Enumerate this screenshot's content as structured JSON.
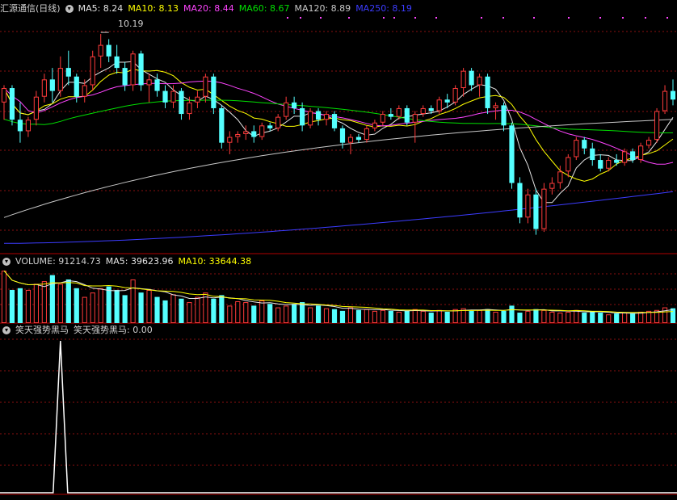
{
  "colors": {
    "up": "#ff3b3b",
    "down": "#55ffff",
    "frame": "#b00000",
    "grid": "#8a1010",
    "ma5": "#e6e6e6",
    "ma10": "#ffff00",
    "ma20": "#ff44ff",
    "ma60": "#00e000",
    "ma120": "#c8c8c8",
    "ma250": "#3c3cff",
    "label": "#d0d0d0"
  },
  "header": {
    "title": "汇源通信(日线)",
    "ma5": "MA5: 8.24",
    "ma10": "MA10: 8.13",
    "ma20": "MA20: 8.44",
    "ma60": "MA60: 8.67",
    "ma120": "MA120: 8.89",
    "ma250": "MA250: 8.19"
  },
  "volume_header": {
    "vol": "VOLUME: 91214.73",
    "ma5": "MA5: 39623.96",
    "ma10": "MA10: 33644.38"
  },
  "indicator_header": {
    "name": "笑天强势黑马",
    "value": "笑天强势黑马: 0.00"
  },
  "max_label": "10.19",
  "chart_data": [
    {
      "type": "candlestick",
      "ylim": [
        6.4,
        10.5
      ],
      "candles": [
        [
          9.0,
          9.3,
          8.7,
          9.25
        ],
        [
          9.25,
          9.3,
          8.6,
          8.7
        ],
        [
          8.7,
          9.0,
          8.3,
          8.5
        ],
        [
          8.5,
          8.75,
          8.4,
          8.7
        ],
        [
          8.7,
          9.2,
          8.6,
          9.1
        ],
        [
          9.1,
          9.5,
          9.0,
          9.4
        ],
        [
          9.4,
          9.6,
          9.0,
          9.2
        ],
        [
          9.2,
          9.8,
          9.1,
          9.6
        ],
        [
          9.6,
          9.9,
          9.3,
          9.45
        ],
        [
          9.45,
          9.5,
          9.0,
          9.1
        ],
        [
          9.1,
          9.4,
          9.0,
          9.3
        ],
        [
          9.3,
          9.9,
          9.2,
          9.8
        ],
        [
          9.8,
          10.19,
          9.6,
          10.0
        ],
        [
          10.0,
          10.1,
          9.7,
          9.8
        ],
        [
          9.8,
          10.0,
          9.5,
          9.6
        ],
        [
          9.6,
          9.7,
          9.2,
          9.3
        ],
        [
          9.3,
          9.9,
          9.2,
          9.85
        ],
        [
          9.85,
          9.9,
          9.2,
          9.3
        ],
        [
          9.3,
          9.5,
          9.0,
          9.4
        ],
        [
          9.4,
          9.5,
          9.1,
          9.2
        ],
        [
          9.2,
          9.3,
          8.9,
          9.0
        ],
        [
          9.0,
          9.3,
          8.9,
          9.2
        ],
        [
          9.2,
          9.25,
          8.7,
          8.8
        ],
        [
          8.8,
          9.1,
          8.7,
          9.0
        ],
        [
          9.0,
          9.2,
          8.9,
          9.1
        ],
        [
          9.1,
          9.5,
          9.0,
          9.45
        ],
        [
          9.45,
          9.5,
          8.8,
          8.9
        ],
        [
          8.9,
          8.95,
          8.2,
          8.3
        ],
        [
          8.3,
          8.5,
          8.1,
          8.4
        ],
        [
          8.4,
          8.5,
          8.3,
          8.45
        ],
        [
          8.45,
          8.6,
          8.35,
          8.5
        ],
        [
          8.5,
          8.6,
          8.3,
          8.4
        ],
        [
          8.4,
          8.65,
          8.35,
          8.6
        ],
        [
          8.6,
          8.65,
          8.5,
          8.55
        ],
        [
          8.55,
          8.8,
          8.5,
          8.75
        ],
        [
          8.75,
          9.1,
          8.7,
          9.0
        ],
        [
          9.0,
          9.1,
          8.8,
          8.9
        ],
        [
          8.9,
          9.0,
          8.5,
          8.6
        ],
        [
          8.6,
          8.9,
          8.55,
          8.85
        ],
        [
          8.85,
          8.9,
          8.6,
          8.7
        ],
        [
          8.7,
          8.85,
          8.6,
          8.8
        ],
        [
          8.8,
          8.85,
          8.5,
          8.55
        ],
        [
          8.55,
          8.6,
          8.2,
          8.3
        ],
        [
          8.3,
          8.45,
          8.1,
          8.4
        ],
        [
          8.4,
          8.45,
          8.3,
          8.35
        ],
        [
          8.35,
          8.6,
          8.3,
          8.55
        ],
        [
          8.55,
          8.7,
          8.5,
          8.65
        ],
        [
          8.65,
          8.85,
          8.6,
          8.8
        ],
        [
          8.8,
          8.9,
          8.7,
          8.75
        ],
        [
          8.75,
          8.95,
          8.7,
          8.9
        ],
        [
          8.9,
          8.95,
          8.6,
          8.65
        ],
        [
          8.65,
          8.85,
          8.3,
          8.8
        ],
        [
          8.8,
          8.95,
          8.75,
          8.9
        ],
        [
          8.9,
          8.95,
          8.8,
          8.85
        ],
        [
          8.85,
          9.1,
          8.8,
          9.05
        ],
        [
          9.05,
          9.15,
          8.9,
          9.0
        ],
        [
          9.0,
          9.3,
          8.95,
          9.25
        ],
        [
          9.25,
          9.6,
          9.1,
          9.55
        ],
        [
          9.55,
          9.6,
          9.2,
          9.3
        ],
        [
          9.3,
          9.5,
          9.1,
          9.45
        ],
        [
          9.45,
          9.5,
          8.8,
          8.9
        ],
        [
          8.9,
          9.0,
          8.7,
          8.95
        ],
        [
          8.95,
          9.0,
          8.5,
          8.6
        ],
        [
          8.6,
          8.65,
          7.5,
          7.6
        ],
        [
          7.6,
          7.7,
          6.9,
          7.0
        ],
        [
          7.0,
          7.5,
          6.9,
          7.4
        ],
        [
          7.4,
          7.5,
          6.7,
          6.8
        ],
        [
          6.8,
          7.6,
          6.75,
          7.5
        ],
        [
          7.5,
          7.7,
          7.4,
          7.6
        ],
        [
          7.6,
          7.9,
          7.5,
          7.8
        ],
        [
          7.8,
          8.1,
          7.7,
          8.05
        ],
        [
          8.05,
          8.4,
          8.0,
          8.35
        ],
        [
          8.35,
          8.4,
          8.1,
          8.2
        ],
        [
          8.2,
          8.3,
          7.9,
          8.0
        ],
        [
          8.0,
          8.1,
          7.8,
          7.85
        ],
        [
          7.85,
          8.05,
          7.8,
          8.0
        ],
        [
          8.0,
          8.1,
          7.9,
          7.95
        ],
        [
          7.95,
          8.2,
          7.9,
          8.15
        ],
        [
          8.15,
          8.2,
          7.95,
          8.0
        ],
        [
          8.0,
          8.3,
          7.95,
          8.25
        ],
        [
          8.25,
          8.4,
          8.2,
          8.35
        ],
        [
          8.35,
          8.9,
          8.3,
          8.85
        ],
        [
          8.85,
          9.3,
          8.8,
          9.2
        ],
        [
          9.2,
          9.4,
          8.95,
          9.05
        ]
      ],
      "volumes": [
        60,
        38,
        40,
        38,
        45,
        48,
        55,
        45,
        50,
        40,
        30,
        35,
        40,
        42,
        38,
        32,
        50,
        35,
        38,
        30,
        26,
        33,
        28,
        24,
        30,
        35,
        28,
        32,
        20,
        25,
        24,
        20,
        26,
        22,
        18,
        20,
        22,
        24,
        18,
        20,
        17,
        16,
        14,
        18,
        15,
        16,
        14,
        15,
        14,
        13,
        14,
        16,
        14,
        12,
        15,
        13,
        16,
        17,
        14,
        15,
        16,
        13,
        14,
        20,
        12,
        14,
        16,
        15,
        13,
        12,
        13,
        15,
        12,
        13,
        12,
        10,
        11,
        12,
        11,
        13,
        14,
        15,
        18,
        17
      ],
      "ma_style": "moving averages"
    },
    {
      "type": "line",
      "name": "笑天强势黑马",
      "signal_index": 7,
      "values_note": ""
    }
  ]
}
